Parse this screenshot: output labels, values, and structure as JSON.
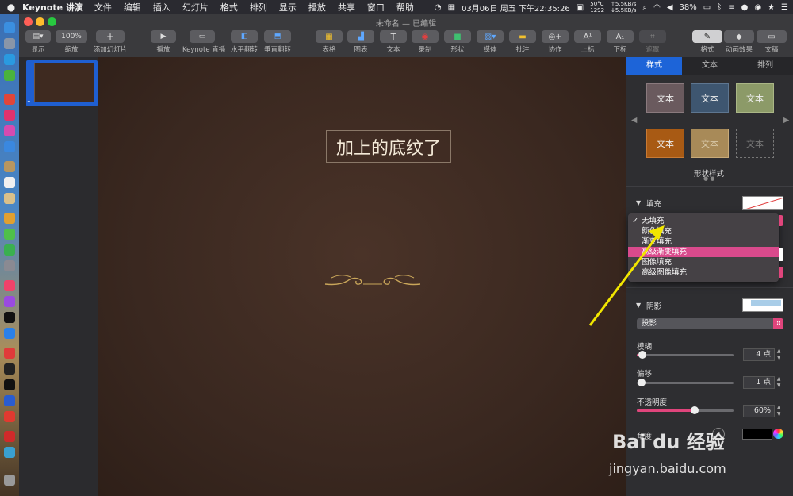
{
  "menubar": {
    "app_name": "Keynote 讲演",
    "items": [
      "文件",
      "编辑",
      "插入",
      "幻灯片",
      "格式",
      "排列",
      "显示",
      "播放",
      "共享",
      "窗口",
      "帮助"
    ],
    "clock": "03月06日 周五 下午22:35:26",
    "temp": "50°C",
    "rpm": "1292",
    "net_up": "↑5.5KB/s",
    "net_down": "↓5.5KB/s",
    "battery": "38%"
  },
  "window": {
    "title": "未命名 — 已编辑"
  },
  "toolbar": {
    "view": "显示",
    "zoom_value": "100%",
    "zoom": "缩放",
    "add_slide": "添加幻灯片",
    "play": "播放",
    "keynote_live": "Keynote 直播",
    "flip_h": "水平翻转",
    "flip_v": "垂直翻转",
    "table": "表格",
    "chart": "图表",
    "text": "文本",
    "record": "录制",
    "shape": "形状",
    "media": "媒体",
    "comment": "批注",
    "collaborate": "协作",
    "superscript": "上标",
    "subscript": "下标",
    "mask": "遮罩",
    "format": "格式",
    "animate": "动画效果",
    "document": "文稿"
  },
  "navigator": {
    "slide_number": "1"
  },
  "slide": {
    "title": "加上的底纹了"
  },
  "inspector": {
    "tabs": [
      "样式",
      "文本",
      "排列"
    ],
    "style_swatch_label": "文本",
    "shape_styles_label": "形状样式",
    "fill_label": "填充",
    "fill_options": [
      "无填充",
      "颜色填充",
      "渐变填充",
      "高级渐变填充",
      "图像填充",
      "高级图像填充"
    ],
    "fill_selected": "无填充",
    "fill_highlighted": "高级渐变填充",
    "shadow_label": "阴影",
    "shadow_type": "投影",
    "blur_label": "模糊",
    "blur_value": "4 点",
    "offset_label": "偏移",
    "offset_value": "1 点",
    "opacity_label": "不透明度",
    "opacity_value": "60%",
    "opacity_fraction": 0.6,
    "angle_label": "角度"
  },
  "colors": {
    "accent": "#1d64d8",
    "highlight": "#d94a8c",
    "arrow": "#f2e600"
  },
  "watermark": {
    "brand": "Bai du 经验",
    "url": "jingyan.baidu.com"
  }
}
